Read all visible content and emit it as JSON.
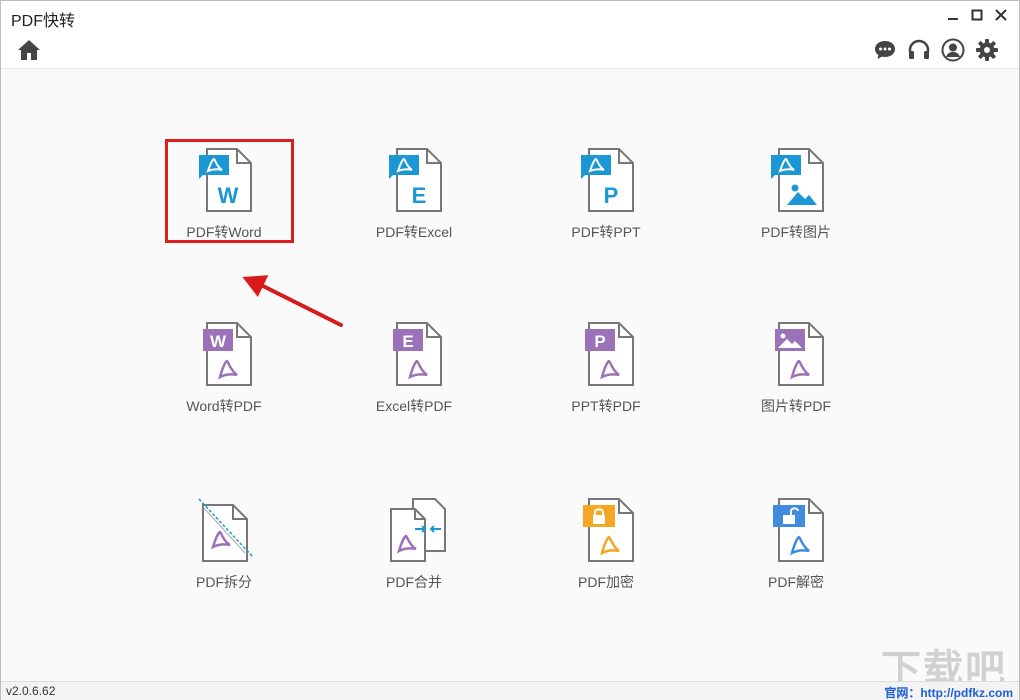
{
  "app": {
    "title": "PDF快转"
  },
  "window_controls": {
    "minimize": "minimize-icon",
    "maximize": "maximize-icon",
    "close": "close-icon"
  },
  "toolbar": {
    "left": [
      "home-icon"
    ],
    "right": [
      "chat-icon",
      "headset-icon",
      "user-icon",
      "gear-icon"
    ]
  },
  "tools": [
    {
      "label": "PDF转Word",
      "letter": "W"
    },
    {
      "label": "PDF转Excel",
      "letter": "E"
    },
    {
      "label": "PDF转PPT",
      "letter": "P"
    },
    {
      "label": "PDF转图片",
      "letter": ""
    },
    {
      "label": "Word转PDF",
      "letter": "W"
    },
    {
      "label": "Excel转PDF",
      "letter": "E"
    },
    {
      "label": "PPT转PDF",
      "letter": "P"
    },
    {
      "label": "图片转PDF",
      "letter": ""
    },
    {
      "label": "PDF拆分",
      "letter": ""
    },
    {
      "label": "PDF合并",
      "letter": ""
    },
    {
      "label": "PDF加密",
      "letter": ""
    },
    {
      "label": "PDF解密",
      "letter": ""
    }
  ],
  "status": {
    "version": "v2.0.6.62",
    "site": "官网：http://pdfkz.com"
  },
  "watermark": "下载吧",
  "colors": {
    "blue": "#1a97d4",
    "purple": "#9b72b8",
    "orange": "#f5a623",
    "lock_blue": "#3f8be0",
    "highlight": "#e01d1d"
  }
}
